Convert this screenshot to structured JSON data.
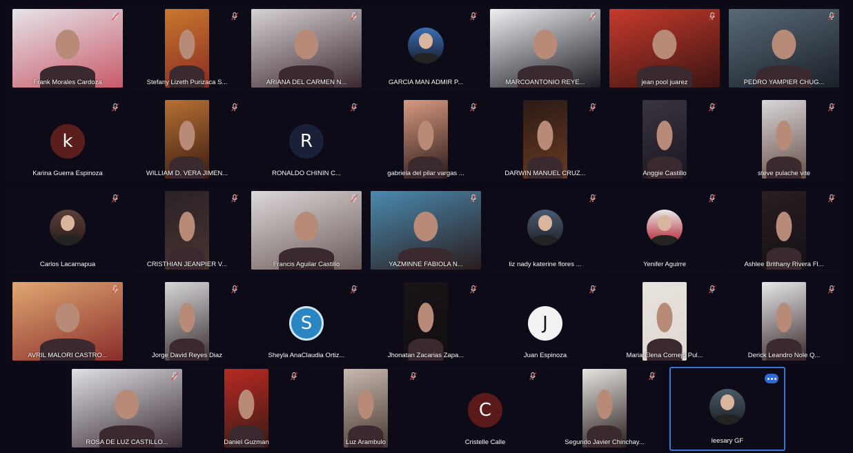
{
  "participants": [
    {
      "name": "Frank Morales Cardoza",
      "kind": "video",
      "wide": true,
      "colors": [
        "#e6e4e8",
        "#c85a6a"
      ]
    },
    {
      "name": "Stefany Lizeth Purizaca S...",
      "kind": "video",
      "colors": [
        "#c9772e",
        "#8a2c22"
      ]
    },
    {
      "name": "ARIANA DEL CARMEN N...",
      "kind": "video",
      "wide": true,
      "colors": [
        "#d8d2d4",
        "#3a2830"
      ]
    },
    {
      "name": "GARCIA MAN ADMIR P...",
      "kind": "photo",
      "colors": [
        "#3a6fb2",
        "#1a1c30"
      ]
    },
    {
      "name": "MARCOANTONIO REYE...",
      "kind": "video",
      "wide": true,
      "colors": [
        "#eef0f2",
        "#1a1a22"
      ]
    },
    {
      "name": "jean pool juarez",
      "kind": "video",
      "wide": true,
      "colors": [
        "#c83a2c",
        "#3a1412"
      ]
    },
    {
      "name": "PEDRO YAMPIER CHUG...",
      "kind": "video",
      "wide": true,
      "colors": [
        "#5a6a78",
        "#1a2028"
      ]
    },
    {
      "name": "Karina Guerra Espinoza",
      "kind": "initial",
      "initial": "k",
      "colors": [
        "#5a1e1c"
      ]
    },
    {
      "name": "WILLIAM D. VERA JIMEN...",
      "kind": "video",
      "colors": [
        "#b87032",
        "#3a1c14"
      ]
    },
    {
      "name": "RONALDO CHININ C...",
      "kind": "initial",
      "initial": "R",
      "colors": [
        "#1a2038"
      ]
    },
    {
      "name": "gabriela del pilar vargas ...",
      "kind": "video",
      "colors": [
        "#d89a82",
        "#2a1a18"
      ]
    },
    {
      "name": "DARWIN MANUEL CRUZ...",
      "kind": "video",
      "colors": [
        "#2a1a16",
        "#6a3a22"
      ]
    },
    {
      "name": "Anggie Castillo",
      "kind": "video",
      "colors": [
        "#3a3440",
        "#1a1620"
      ]
    },
    {
      "name": "steve pulache vite",
      "kind": "video",
      "colors": [
        "#d8d6d8",
        "#6a5048"
      ]
    },
    {
      "name": "Carlos Lacarnapua",
      "kind": "photo",
      "colors": [
        "#5a4038",
        "#2a1a1a"
      ]
    },
    {
      "name": "CRISTHIAN JEANPIER V...",
      "kind": "video",
      "colors": [
        "#2a2226",
        "#4a3430"
      ]
    },
    {
      "name": "Francis Aguilar Castillo",
      "kind": "video",
      "wide": true,
      "colors": [
        "#ded8d8",
        "#6a5a5a"
      ]
    },
    {
      "name": "YAZMINNE FABIOLA N...",
      "kind": "video",
      "wide": true,
      "colors": [
        "#4a8ab0",
        "#2a1c1c"
      ]
    },
    {
      "name": "liz nady katerine flores ...",
      "kind": "photo",
      "colors": [
        "#4a5a70",
        "#202228"
      ]
    },
    {
      "name": "Yenifer Aguirre",
      "kind": "photo",
      "colors": [
        "#eaeaea",
        "#b01c2a"
      ]
    },
    {
      "name": "Ashlee Brithany Rivera Fl...",
      "kind": "video",
      "colors": [
        "#2a1e22",
        "#141014"
      ]
    },
    {
      "name": "AVRIL MALORI CASTRO...",
      "kind": "video",
      "wide": true,
      "colors": [
        "#e0a872",
        "#8a2c2a"
      ]
    },
    {
      "name": "Jorge David Reyes Diaz",
      "kind": "video",
      "colors": [
        "#d8d6da",
        "#3a3032"
      ]
    },
    {
      "name": "Sheyla AnaClaudia Ortiz...",
      "kind": "initial",
      "initial": "S",
      "colors": [
        "#2a86c2"
      ]
    },
    {
      "name": "Jhonatan Zacarias Zapa...",
      "kind": "video",
      "colors": [
        "#1a1216",
        "#120e12"
      ]
    },
    {
      "name": "Juan Espinoza",
      "kind": "initial",
      "initial": "J",
      "colors": [
        "#f2f2f2"
      ],
      "initial_color": "#111111"
    },
    {
      "name": "Maria Elena Cornejo Pul...",
      "kind": "video",
      "colors": [
        "#e8e2dc",
        "#e0d8d2"
      ]
    },
    {
      "name": "Derick Leandro Nole Q...",
      "kind": "video",
      "colors": [
        "#e8e8ea",
        "#3a2a2a"
      ]
    },
    {
      "name": "ROSA DE LUZ CASTILLO...",
      "kind": "video",
      "wide": true,
      "colors": [
        "#e0e0e4",
        "#3a2a34"
      ]
    },
    {
      "name": "Daniel Guzman",
      "kind": "video",
      "colors": [
        "#b82a22",
        "#3a1a16"
      ]
    },
    {
      "name": "Luz Arambulo",
      "kind": "video",
      "colors": [
        "#c8bab0",
        "#4a3a34"
      ]
    },
    {
      "name": "Cristelle Calle",
      "kind": "initial",
      "initial": "C",
      "colors": [
        "#5a1a1a"
      ]
    },
    {
      "name": "Segundo Javier Chinchay...",
      "kind": "video",
      "colors": [
        "#e8e4e0",
        "#2a201e"
      ]
    },
    {
      "name": "leesary GF",
      "kind": "photo",
      "active": true,
      "colors": [
        "#4a5a66",
        "#1c2026"
      ]
    }
  ],
  "colors": {
    "background": "#0c0a16",
    "active_border": "#3a78d8",
    "name_text": "#ffffff"
  },
  "icons": {
    "mute": "microphone-muted-icon",
    "more": "more-options-icon"
  }
}
